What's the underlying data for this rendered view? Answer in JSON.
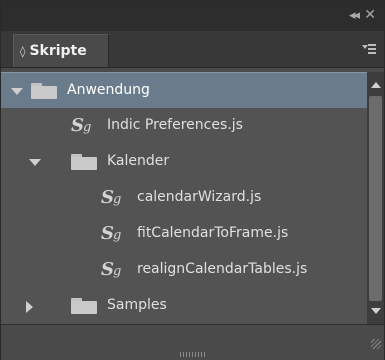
{
  "titlebar": {
    "collapse_icon": "double-chevron-left-icon",
    "collapse_glyph": "◂◂",
    "close_icon": "close-icon",
    "close_glyph": "✕"
  },
  "panel": {
    "tab_label": "Skripte",
    "tab_icon": "up-down-arrows-icon",
    "tab_glyph": "◊",
    "menu_icon": "panel-menu-icon"
  },
  "colors": {
    "panel_bg": "#4a4a4a",
    "list_bg": "#535353",
    "selection": "#6a7b8c",
    "text": "#e0e0e0"
  },
  "tree": [
    {
      "label": "Anwendung",
      "type": "folder",
      "state": "expanded",
      "selected": true
    },
    {
      "label": "Indic Preferences.js",
      "type": "script"
    },
    {
      "label": "Kalender",
      "type": "folder",
      "state": "expanded"
    },
    {
      "label": "calendarWizard.js",
      "type": "script"
    },
    {
      "label": "fitCalendarToFrame.js",
      "type": "script"
    },
    {
      "label": "realignCalendarTables.js",
      "type": "script"
    },
    {
      "label": "Samples",
      "type": "folder",
      "state": "collapsed"
    }
  ]
}
